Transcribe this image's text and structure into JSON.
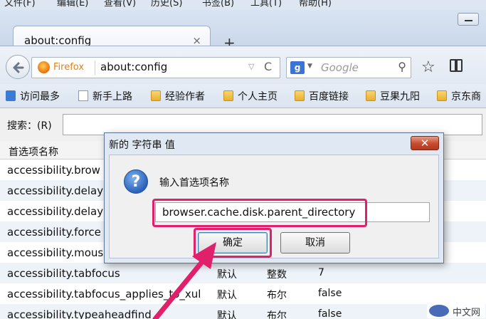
{
  "menu": {
    "items": [
      "文件(F)",
      "编辑(E)",
      "查看(V)",
      "历史(S)",
      "书签(B)",
      "工具(T)",
      "帮助(H)"
    ]
  },
  "tab": {
    "title": "about:config",
    "close": "×",
    "new_tab": "+"
  },
  "nav": {
    "identity_label": "Firefox",
    "url": "about:config",
    "dropdown": "▽",
    "reload": "C",
    "search_engine": "g",
    "search_placeholder": "Google",
    "star": "☆"
  },
  "bookmarks": [
    "访问最多",
    "新手上路",
    "经验作者",
    "个人主页",
    "百度链接",
    "豆果九阳",
    "京东商"
  ],
  "filter": {
    "label": "搜索：(R)",
    "value": ""
  },
  "table": {
    "header_name": "首选项名称",
    "rows": [
      {
        "name": "accessibility.brow",
        "status": "",
        "type": "",
        "value": ""
      },
      {
        "name": "accessibility.delay",
        "status": "",
        "type": "",
        "value": ""
      },
      {
        "name": "accessibility.delay",
        "status": "",
        "type": "",
        "value": ""
      },
      {
        "name": "accessibility.force",
        "status": "",
        "type": "",
        "value": ""
      },
      {
        "name": "accessibility.mous",
        "status": "",
        "type": "",
        "value": ""
      },
      {
        "name": "accessibility.tabfocus",
        "status": "默认",
        "type": "整数",
        "value": "7"
      },
      {
        "name": "accessibility.tabfocus_applies_to_xul",
        "status": "默认",
        "type": "布尔",
        "value": "false"
      },
      {
        "name": "accessibility.typeaheadfind",
        "status": "默认",
        "type": "布尔",
        "value": "false"
      }
    ]
  },
  "dialog": {
    "title": "新的 字符串 值",
    "close": "✕",
    "icon_glyph": "?",
    "prompt": "输入首选项名称",
    "input_value": "browser.cache.disk.parent_directory",
    "ok_label": "确定",
    "cancel_label": "取消"
  },
  "watermark": {
    "text": "中文网",
    "logo_text": "php"
  },
  "colors": {
    "highlight": "#e0206a",
    "dialog_frame": "#dfe8f3",
    "close_button": "#c64a2f"
  }
}
